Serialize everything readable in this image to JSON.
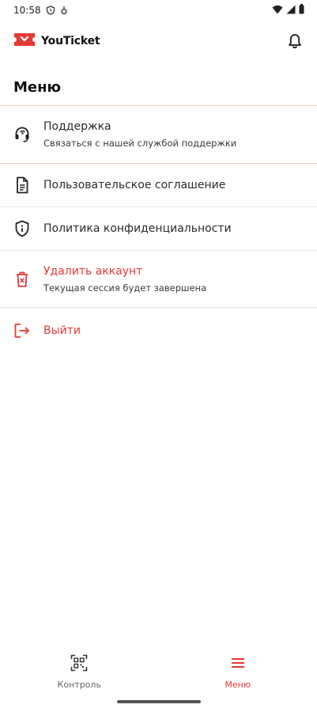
{
  "status_bar": {
    "time": "10:58",
    "icons": [
      "shield-clock-icon",
      "fan-icon",
      "wifi-icon",
      "signal-icon",
      "battery-icon"
    ]
  },
  "header": {
    "app_name": "YouTicket",
    "brand_color": "#e53935",
    "notification_icon": "bell-icon"
  },
  "page": {
    "title": "Меню"
  },
  "menu": {
    "items": [
      {
        "icon": "headset-icon",
        "title": "Поддержка",
        "subtitle": "Связаться с нашей службой поддержки"
      },
      {
        "icon": "document-icon",
        "title": "Пользовательское соглашение"
      },
      {
        "icon": "shield-info-icon",
        "title": "Политика конфиденциальности"
      },
      {
        "icon": "trash-icon",
        "title": "Удалить аккаунт",
        "subtitle": "Текущая сессия будет завершена",
        "color": "#e53935"
      },
      {
        "icon": "logout-icon",
        "title": "Выйти",
        "color": "#e53935"
      }
    ]
  },
  "bottom_nav": {
    "items": [
      {
        "icon": "qr-scan-icon",
        "label": "Контроль",
        "active": false
      },
      {
        "icon": "menu-icon",
        "label": "Меню",
        "active": true
      }
    ],
    "active_color": "#e53935"
  }
}
